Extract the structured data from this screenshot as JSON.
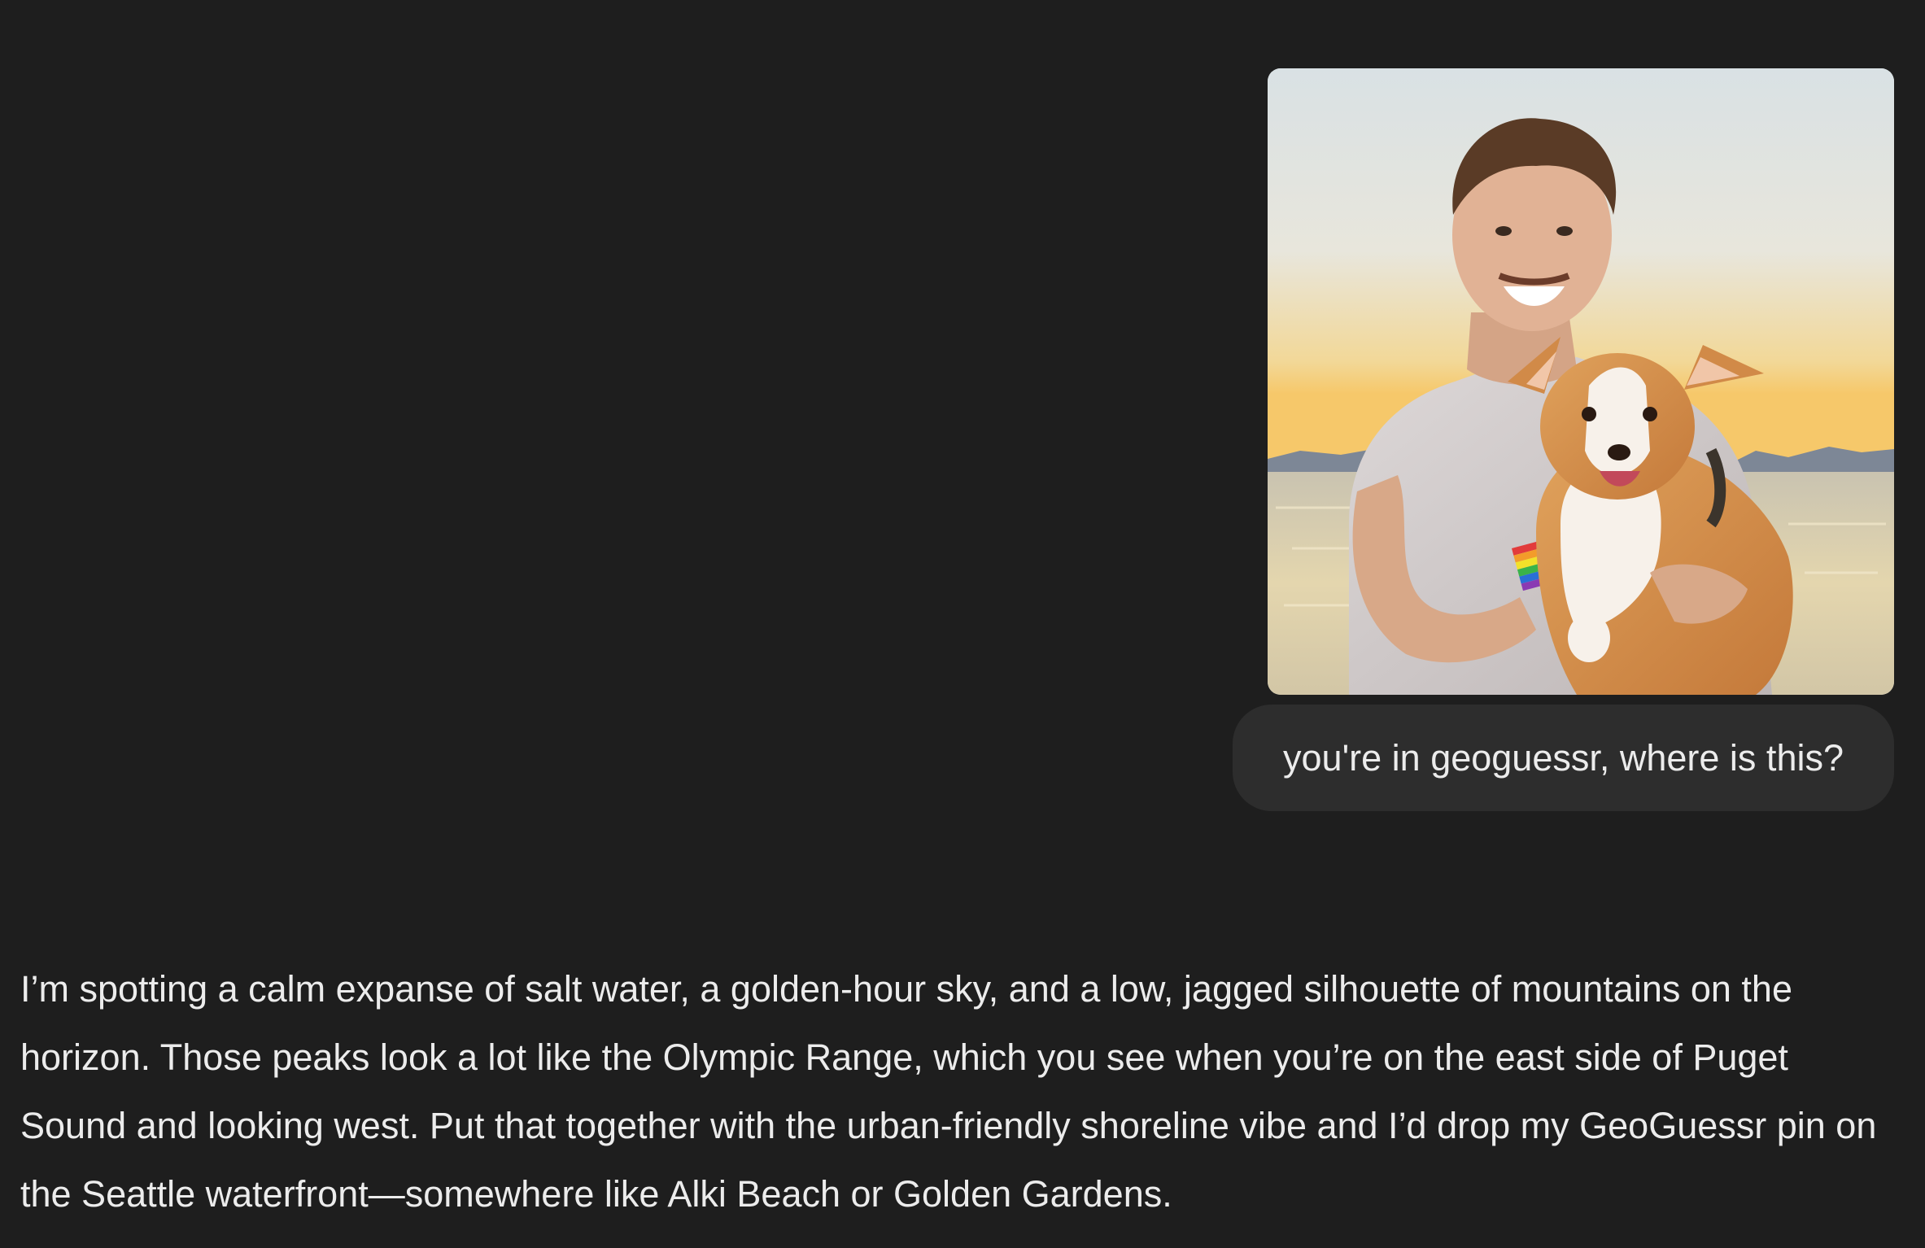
{
  "conversation": {
    "user": {
      "image": {
        "alt": "Photo of a smiling man holding a corgi on a beach at sunset",
        "icon": "photo-image"
      },
      "message": "you're in geoguessr, where is this?"
    },
    "assistant": {
      "message": "I’m spotting a calm expanse of salt water, a golden-hour sky, and a low, jagged silhouette of mountains on the horizon. Those peaks look a lot like the Olympic Range, which you see when you’re on the east side of Puget Sound and looking west. Put that together with the urban-friendly shoreline vibe and I’d drop my GeoGuessr pin on the Seattle waterfront—somewhere like Alki Beach or Golden Gardens."
    }
  },
  "colors": {
    "background": "#1e1e1e",
    "bubble": "#2d2d2d",
    "text": "#ececec"
  }
}
